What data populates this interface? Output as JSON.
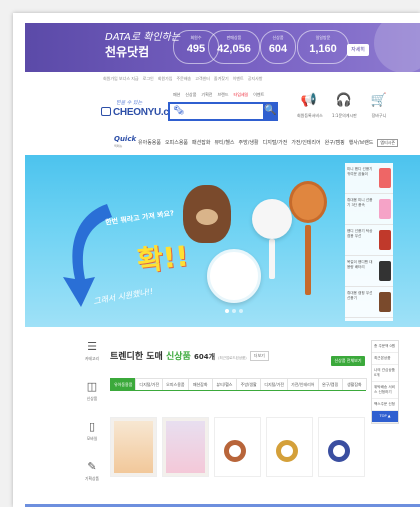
{
  "stats_banner": {
    "tagline_1": "DATA로 확인하는",
    "tagline_2": "천유닷컴",
    "stats": [
      {
        "label": "회원수",
        "value": "495"
      },
      {
        "label": "판매상품",
        "value": "42,056"
      },
      {
        "label": "신상품",
        "value": "604"
      },
      {
        "label": "일일방문",
        "value": "1,160"
      }
    ],
    "more_label": "자세히"
  },
  "top_links": [
    "회원가입 보너스 지급",
    "로그인",
    "회원가입",
    "주문배송",
    "고객센터",
    "즐겨찾기",
    "이벤트",
    "공지사항"
  ],
  "header": {
    "logo_tagline": "믿을 수 있는",
    "logo_text": "CHEONYU.com",
    "keywords": [
      "패션",
      "신상품",
      "기획전",
      "브랜드",
      "타임세일",
      "이벤트"
    ],
    "search_category": "🗞",
    "search_button_icon": "🔍",
    "icons": [
      {
        "name": "megaphone-icon",
        "glyph": "📢",
        "label": "회원등록서비스"
      },
      {
        "name": "headset-icon",
        "glyph": "🎧",
        "label": "1:1문의게시판"
      },
      {
        "name": "cart-icon",
        "glyph": "🛒",
        "label": "장바구니"
      }
    ]
  },
  "nav": {
    "quick_label": "Quick",
    "quick_sub": "퀵메뉴",
    "items": [
      "유아동용품",
      "오피스용품",
      "패션잡화",
      "뷰티/헬스",
      "주방/생활",
      "디지털/가전",
      "가전/인테리어",
      "완구/캠핑",
      "행사/브랜드",
      "엠티시즌"
    ]
  },
  "hero": {
    "bubble_text": "한번 뭐라고 가져 봐요?",
    "big_text": "확!!",
    "hand_text": "그래서 시원했나!!",
    "side_items": [
      {
        "text": "미니 핸디 선풍기 귀여운 곰돌이"
      },
      {
        "text": "휴대용 미니 선풍기 3단 풍속"
      },
      {
        "text": "핸디 선풍기 탁상 겸용 무선"
      },
      {
        "text": "목걸이 핸디팬 대용량 배터리"
      },
      {
        "text": "휴대용 캠핑 무선 선풍기"
      }
    ]
  },
  "left_sidebar": [
    {
      "name": "menu-icon",
      "glyph": "☰",
      "label": "카테고리"
    },
    {
      "name": "box-icon",
      "glyph": "◫",
      "label": "신상품"
    },
    {
      "name": "phone-icon",
      "glyph": "▯",
      "label": "모바일"
    },
    {
      "name": "note-icon",
      "glyph": "✎",
      "label": "기획상품"
    }
  ],
  "products_section": {
    "title_prefix": "트렌디한 도매",
    "title_highlight": "신상품",
    "count": "604개",
    "subtitle": "(최근업로드된상품)",
    "small_button": "더보기",
    "green_button": "신상품 전체보기",
    "tabs": [
      "유아동용품",
      "디지털/가전",
      "오피스용품",
      "패션잡화",
      "뷰티/헬스",
      "주방/생활",
      "디지털/가전",
      "가전/인테리어",
      "완구/캠핑",
      "생활잡화"
    ]
  },
  "right_sidebar": [
    "총 주문액 0원",
    "최근본상품",
    "나의 관심상품 0개",
    "위탁배송 서비스 신청하기",
    "팩스주문 신청",
    "TOP ▲"
  ],
  "colors": {
    "primary_blue": "#2f5fd0",
    "banner_purple": "#5b4aa8",
    "accent_green": "#3ba93b",
    "hero_sky": "#4cc3ee"
  }
}
